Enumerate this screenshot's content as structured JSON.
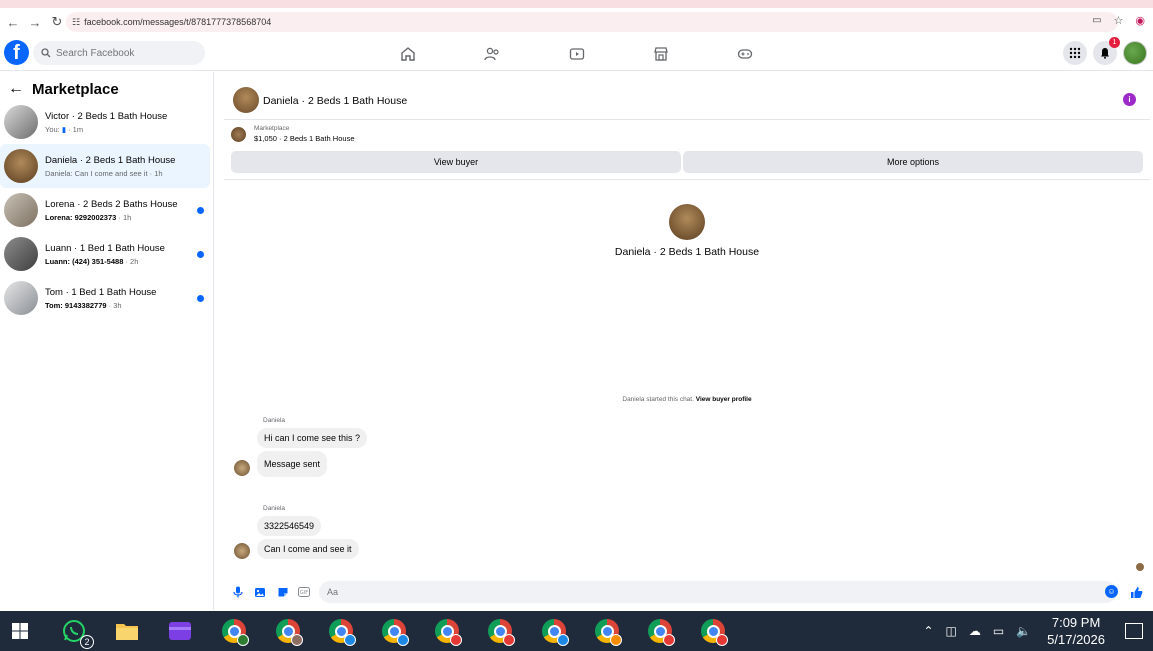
{
  "browser": {
    "url": "facebook.com/messages/t/8781777378568704"
  },
  "header": {
    "search_placeholder": "Search Facebook",
    "notification_count": "1"
  },
  "sidebar": {
    "title": "Marketplace",
    "conversations": [
      {
        "name": "Victor · 2 Beds 1 Bath House",
        "prefix": "You:",
        "time": "· 1m",
        "icon": "thumbs-up-icon",
        "unread": false,
        "active": false
      },
      {
        "name": "Daniela · 2 Beds 1 Bath House",
        "preview": "Daniela: Can I come and see it · 1h",
        "unread": false,
        "active": true
      },
      {
        "name": "Lorena · 2 Beds 2 Baths House",
        "preview_bold": "Lorena: 9292002373",
        "time": " · 1h",
        "unread": true,
        "active": false
      },
      {
        "name": "Luann · 1 Bed 1 Bath House",
        "preview_bold": "Luann: (424) 351-5488",
        "time": " · 2h",
        "unread": true,
        "active": false
      },
      {
        "name": "Tom · 1 Bed 1 Bath House",
        "preview_bold": "Tom: 9143382779",
        "time": " · 3h",
        "unread": true,
        "active": false
      }
    ]
  },
  "chat": {
    "title": "Daniela · 2 Beds 1 Bath House",
    "marketplace_label": "Marketplace",
    "listing": "$1,050 · 2 Beds 1 Bath House",
    "view_buyer": "View buyer",
    "more_options": "More options",
    "center_name": "Daniela · 2 Beds 1 Bath House",
    "started_text": "Daniela started this chat.",
    "view_profile": "View buyer profile",
    "groups": [
      {
        "sender": "Daniela",
        "messages": [
          "Hi can I come see this ?",
          "Message sent"
        ]
      },
      {
        "sender": "Daniela",
        "messages": [
          "3322546549",
          "Can I come and see it"
        ]
      }
    ],
    "composer_placeholder": "Aa"
  },
  "taskbar": {
    "whatsapp_badge": "2",
    "time": "7:09 PM",
    "date": "5/17/2026"
  },
  "colors": {
    "fb_blue": "#0866ff",
    "active_conv": "#ebf5ff",
    "taskbar": "#1f2a3a",
    "info_purple": "#9b2ac8"
  }
}
